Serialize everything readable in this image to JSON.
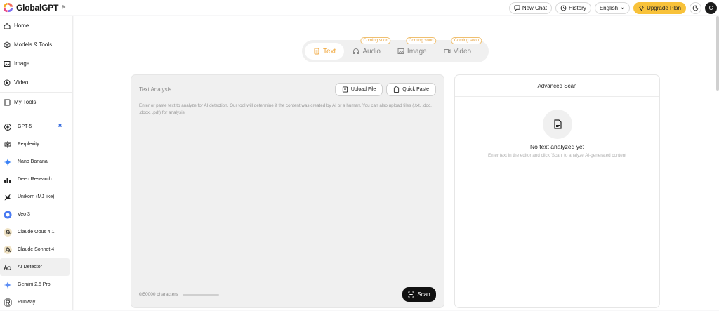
{
  "app": {
    "name": "GlobalGPT",
    "flag": "⚑"
  },
  "header": {
    "new_chat": "New Chat",
    "history": "History",
    "language": "English",
    "upgrade": "Upgrade Plan",
    "avatar_initial": "C"
  },
  "sidebar": {
    "nav": [
      {
        "label": "Home",
        "icon": "home-icon"
      },
      {
        "label": "Models & Tools",
        "icon": "cube-icon"
      },
      {
        "label": "Image",
        "icon": "image-icon"
      },
      {
        "label": "Video",
        "icon": "play-icon"
      },
      {
        "label": "My Tools",
        "icon": "tools-icon"
      }
    ],
    "models": [
      {
        "label": "GPT-5",
        "icon": "openai-icon"
      },
      {
        "label": "Perplexity",
        "icon": "perplexity-icon"
      },
      {
        "label": "Nano Banana",
        "icon": "sparkle-icon"
      },
      {
        "label": "Deep Research",
        "icon": "research-icon"
      },
      {
        "label": "Unikorn (MJ like)",
        "icon": "unicorn-icon"
      },
      {
        "label": "Veo 3",
        "icon": "veo-icon"
      },
      {
        "label": "Claude Opus 4.1",
        "icon": "anthropic-icon"
      },
      {
        "label": "Claude Sonnet 4",
        "icon": "anthropic-icon"
      },
      {
        "label": "AI Detector",
        "icon": "ai-detector-icon"
      },
      {
        "label": "Gemini 2.5 Pro",
        "icon": "gemini-icon"
      },
      {
        "label": "Runway",
        "icon": "runway-icon"
      }
    ]
  },
  "tabs": [
    {
      "label": "Text",
      "badge": ""
    },
    {
      "label": "Audio",
      "badge": "Coming soon"
    },
    {
      "label": "Image",
      "badge": "Coming soon"
    },
    {
      "label": "Video",
      "badge": "Coming soon"
    }
  ],
  "editor": {
    "title": "Text Analysis",
    "upload_file": "Upload File",
    "quick_paste": "Quick Paste",
    "placeholder": "Enter or paste text to analyze for AI detection. Our tool will determine if the content was created by AI or a human. You can also upload files (.txt, .doc, .docx, .pdf) for analysis.",
    "char_count": "0/50000 characters",
    "scan": "Scan"
  },
  "advanced": {
    "title": "Advanced Scan",
    "empty_title": "No text analyzed yet",
    "empty_sub": "Enter text in the editor and click 'Scan' to analyze AI-generated content"
  },
  "colors": {
    "accent": "#f0a63a",
    "upgrade": "#f8c23a",
    "dark": "#111111"
  }
}
